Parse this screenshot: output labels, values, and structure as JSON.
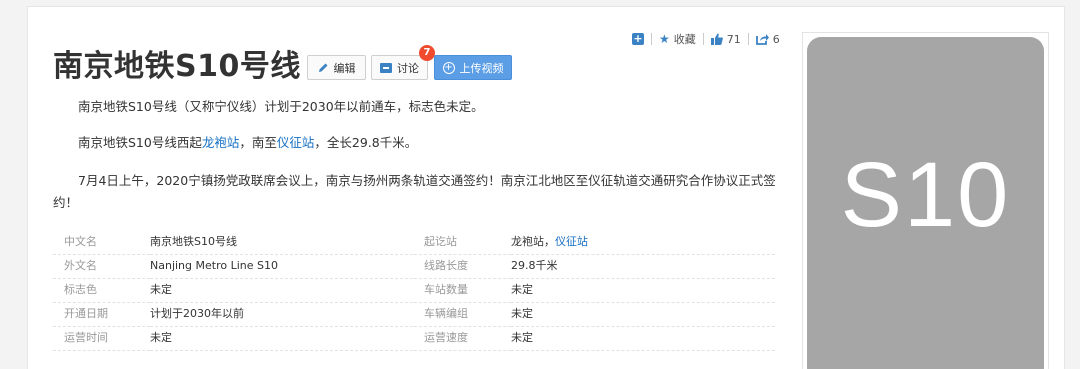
{
  "toolbar": {
    "favorite_label": "收藏",
    "like_count": "71",
    "share_count": "6"
  },
  "title": "南京地铁S10号线",
  "buttons": {
    "edit": "编辑",
    "discuss": "讨论",
    "discuss_badge": "7",
    "upload_video": "上传视频"
  },
  "summary": {
    "p1": "南京地铁S10号线（又称宁仪线）计划于2030年以前通车，标志色未定。",
    "p2_before": "南京地铁S10号线西起",
    "p2_link1": "龙袍站",
    "p2_mid": "，南至",
    "p2_link2": "仪征站",
    "p2_after": "，全长29.8千米。",
    "p3": "7月4日上午，2020宁镇扬党政联席会议上，南京与扬州两条轨道交通签约！南京江北地区至仪征轨道交通研究合作协议正式签约！"
  },
  "info_rows": [
    {
      "k1": "中文名",
      "v1": "南京地铁S10号线",
      "k2": "起讫站",
      "v2": "龙袍站，",
      "v2_link": "仪征站"
    },
    {
      "k1": "外文名",
      "v1": "Nanjing Metro Line S10",
      "k2": "线路长度",
      "v2": "29.8千米"
    },
    {
      "k1": "标志色",
      "v1": "未定",
      "k2": "车站数量",
      "v2": "未定"
    },
    {
      "k1": "开通日期",
      "v1": "计划于2030年以前",
      "k2": "车辆编组",
      "v2": "未定"
    },
    {
      "k1": "运营时间",
      "v1": "未定",
      "k2": "运营速度",
      "v2": "未定"
    }
  ],
  "logo": {
    "text": "S10",
    "bg_color": "#a6a6a6"
  },
  "colors": {
    "accent": "#136ec2",
    "badge": "#f04b2f",
    "upload_button": "#5b9ee6"
  }
}
